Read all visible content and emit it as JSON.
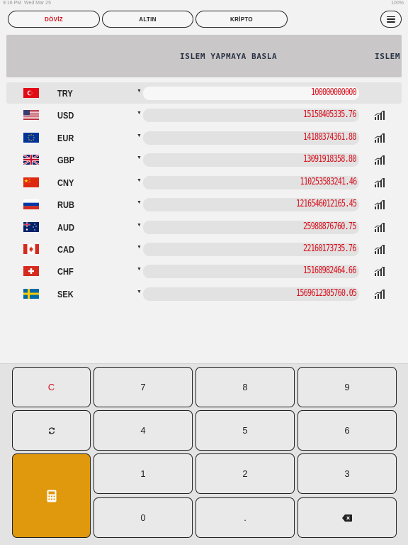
{
  "status": {
    "time": "9:16 PM",
    "date": "Wed Mar 25",
    "battery": "100%"
  },
  "tabs": [
    {
      "label": "DÖVİZ",
      "active": true
    },
    {
      "label": "ALTIN",
      "active": false
    },
    {
      "label": "KRİPTO",
      "active": false
    }
  ],
  "banner": {
    "text": "ISLEM YAPMAYA BASLA",
    "text_repeat": "ISLEM Y"
  },
  "currencies": [
    {
      "code": "TRY",
      "value": "100000000000",
      "flag": "flag-tr",
      "selected": true
    },
    {
      "code": "USD",
      "value": "15158405335.76",
      "flag": "flag-us"
    },
    {
      "code": "EUR",
      "value": "14180374361.88",
      "flag": "flag-eu"
    },
    {
      "code": "GBP",
      "value": "13091918358.80",
      "flag": "flag-gb"
    },
    {
      "code": "CNY",
      "value": "110253583241.46",
      "flag": "flag-cn"
    },
    {
      "code": "RUB",
      "value": "1216546012165.45",
      "flag": "flag-ru"
    },
    {
      "code": "AUD",
      "value": "25988876760.75",
      "flag": "flag-au"
    },
    {
      "code": "CAD",
      "value": "22160173735.76",
      "flag": "flag-ca"
    },
    {
      "code": "CHF",
      "value": "15168982464.66",
      "flag": "flag-ch"
    },
    {
      "code": "SEK",
      "value": "1569612305760.05",
      "flag": "flag-se"
    }
  ],
  "keypad": {
    "clear": "C",
    "seven": "7",
    "eight": "8",
    "nine": "9",
    "four": "4",
    "five": "5",
    "six": "6",
    "one": "1",
    "two": "2",
    "three": "3",
    "zero": "0",
    "dot": "."
  },
  "colors": {
    "accent": "#d0101c",
    "calc_key": "#e0980c"
  }
}
